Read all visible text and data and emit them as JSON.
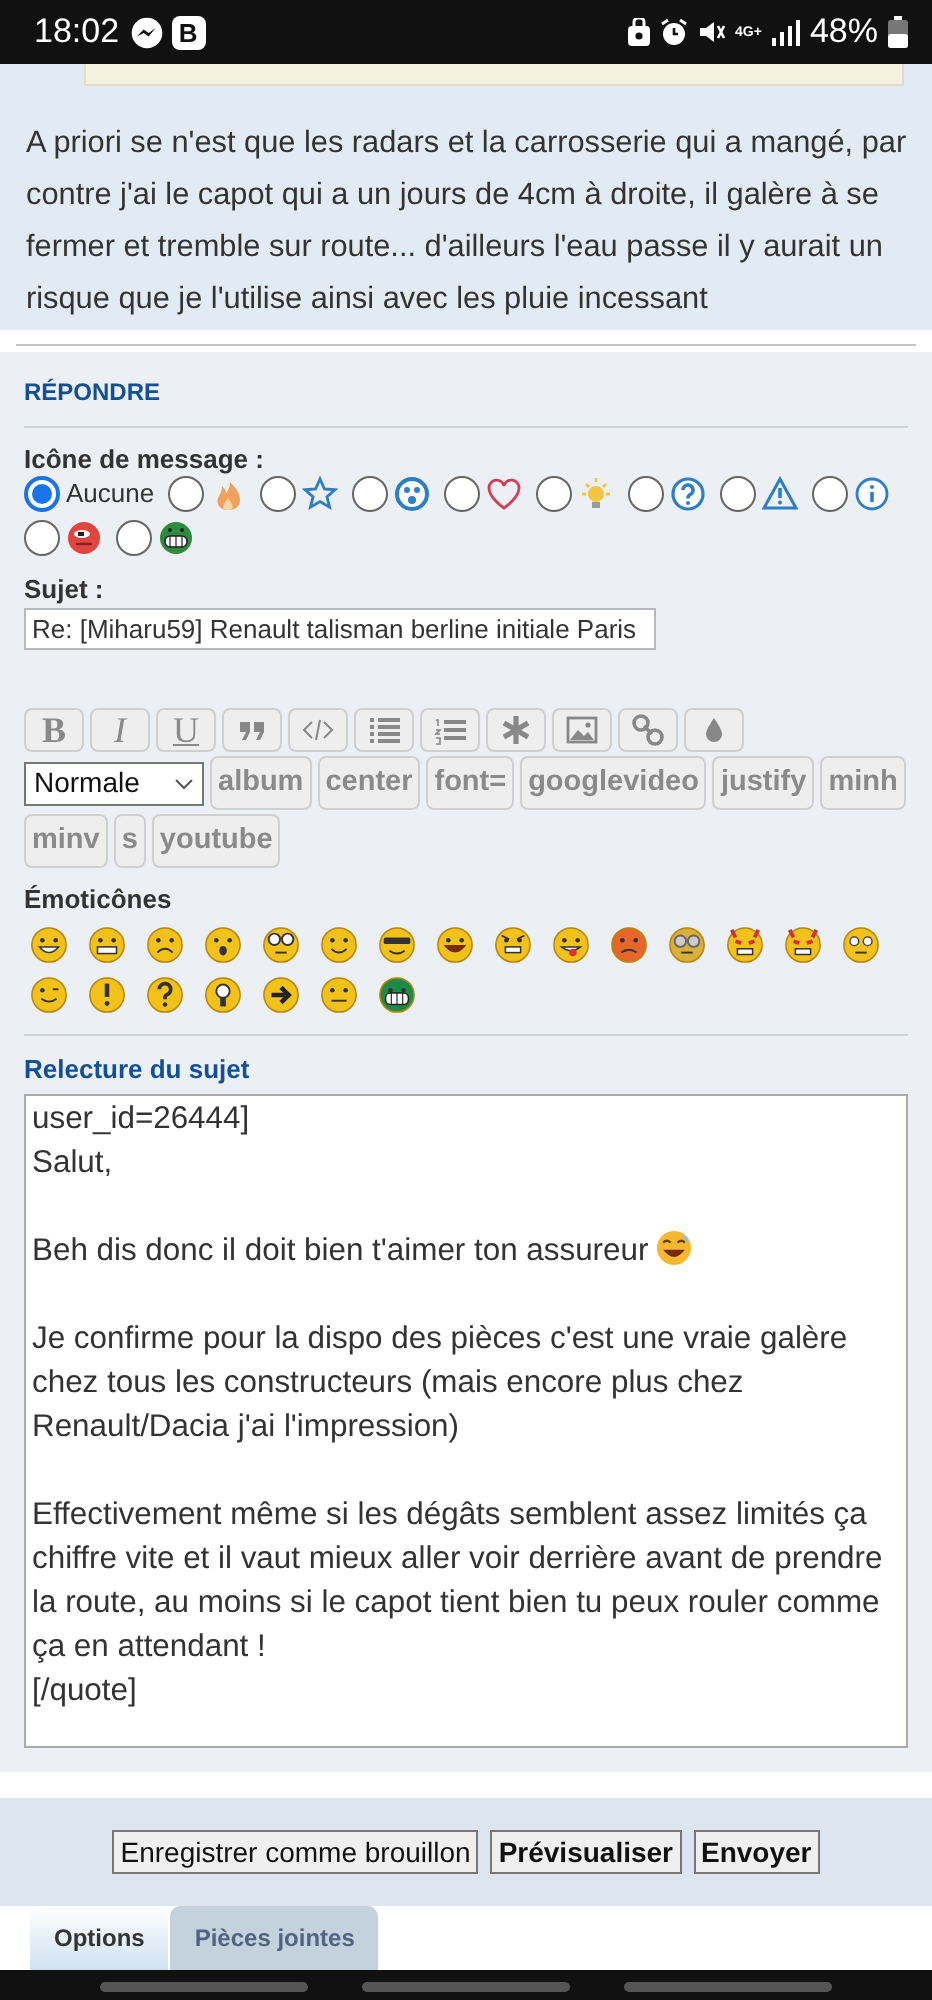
{
  "status_bar": {
    "time": "18:02",
    "app_badge": "B",
    "network": "4G+",
    "battery": "48%"
  },
  "post": {
    "text": "A priori se n'est que les radars et la carrosserie qui a mangé, par contre j'ai le capot qui a un jours de 4cm à droite, il galère à se fermer et tremble sur route... d'ailleurs l'eau passe il y aurait un risque que je l'utilise ainsi avec les pluie incessant"
  },
  "reply": {
    "heading": "RÉPONDRE",
    "icon_label": "Icône de message :",
    "message_icons": [
      {
        "kind": "none",
        "label": "Aucune",
        "selected": true
      },
      {
        "kind": "fire",
        "selected": false
      },
      {
        "kind": "star",
        "selected": false
      },
      {
        "kind": "surprised",
        "selected": false
      },
      {
        "kind": "heart",
        "selected": false
      },
      {
        "kind": "bulb",
        "selected": false
      },
      {
        "kind": "question",
        "selected": false
      },
      {
        "kind": "warning",
        "selected": false
      },
      {
        "kind": "info",
        "selected": false
      },
      {
        "kind": "red-face",
        "selected": false
      },
      {
        "kind": "green-grin",
        "selected": false
      }
    ],
    "subject_label": "Sujet :",
    "subject": "Re: [Miharu59] Renault talisman berline initiale Paris",
    "format_buttons": [
      {
        "kind": "bold",
        "label": "B"
      },
      {
        "kind": "italic",
        "label": "I"
      },
      {
        "kind": "underline",
        "label": "U"
      },
      {
        "kind": "quote"
      },
      {
        "kind": "code"
      },
      {
        "kind": "list"
      },
      {
        "kind": "numbered-list"
      },
      {
        "kind": "asterisk"
      },
      {
        "kind": "image"
      },
      {
        "kind": "link"
      },
      {
        "kind": "drop"
      }
    ],
    "font_size": "Normale",
    "tag_buttons": [
      "album",
      "center",
      "font=",
      "googlevideo",
      "justify",
      "minh",
      "minv",
      "s",
      "youtube"
    ],
    "emoticons_label": "Émoticônes",
    "emoticons": [
      {
        "kind": "grin"
      },
      {
        "kind": "teeth"
      },
      {
        "kind": "sad"
      },
      {
        "kind": "shock"
      },
      {
        "kind": "glasses"
      },
      {
        "kind": "smile"
      },
      {
        "kind": "cool"
      },
      {
        "kind": "laugh"
      },
      {
        "kind": "mad"
      },
      {
        "kind": "tongue"
      },
      {
        "kind": "angry"
      },
      {
        "kind": "gray-glasses"
      },
      {
        "kind": "devil"
      },
      {
        "kind": "devil"
      },
      {
        "kind": "roll"
      },
      {
        "kind": "wink"
      },
      {
        "kind": "exclaim"
      },
      {
        "kind": "question"
      },
      {
        "kind": "idea"
      },
      {
        "kind": "arrow"
      },
      {
        "kind": "neutral"
      },
      {
        "kind": "green"
      }
    ],
    "preview_label": "Relecture du sujet",
    "message": [
      {
        "text": "user_id=26444]\nSalut,"
      },
      {
        "text": "Beh dis donc il doit bien t'aimer ton assureur",
        "emoji": true
      },
      {
        "text": "Je confirme pour la dispo des pièces c'est une vraie galère chez tous les constructeurs (mais encore plus chez Renault/Dacia j'ai l'impression)"
      },
      {
        "text": "Effectivement même si les dégâts semblent assez limités ça chiffre vite et il vaut mieux aller voir derrière avant de prendre la route, au moins si le capot tient bien tu peux rouler comme ça en attendant !\n[/quote]"
      }
    ]
  },
  "buttons": [
    {
      "label": "Enregistrer comme brouillon",
      "bold": false
    },
    {
      "label": "Prévisualiser",
      "bold": true
    },
    {
      "label": "Envoyer",
      "bold": true
    }
  ],
  "tabs": [
    {
      "label": "Options",
      "selected": true
    },
    {
      "label": "Pièces jointes",
      "selected": false
    }
  ]
}
